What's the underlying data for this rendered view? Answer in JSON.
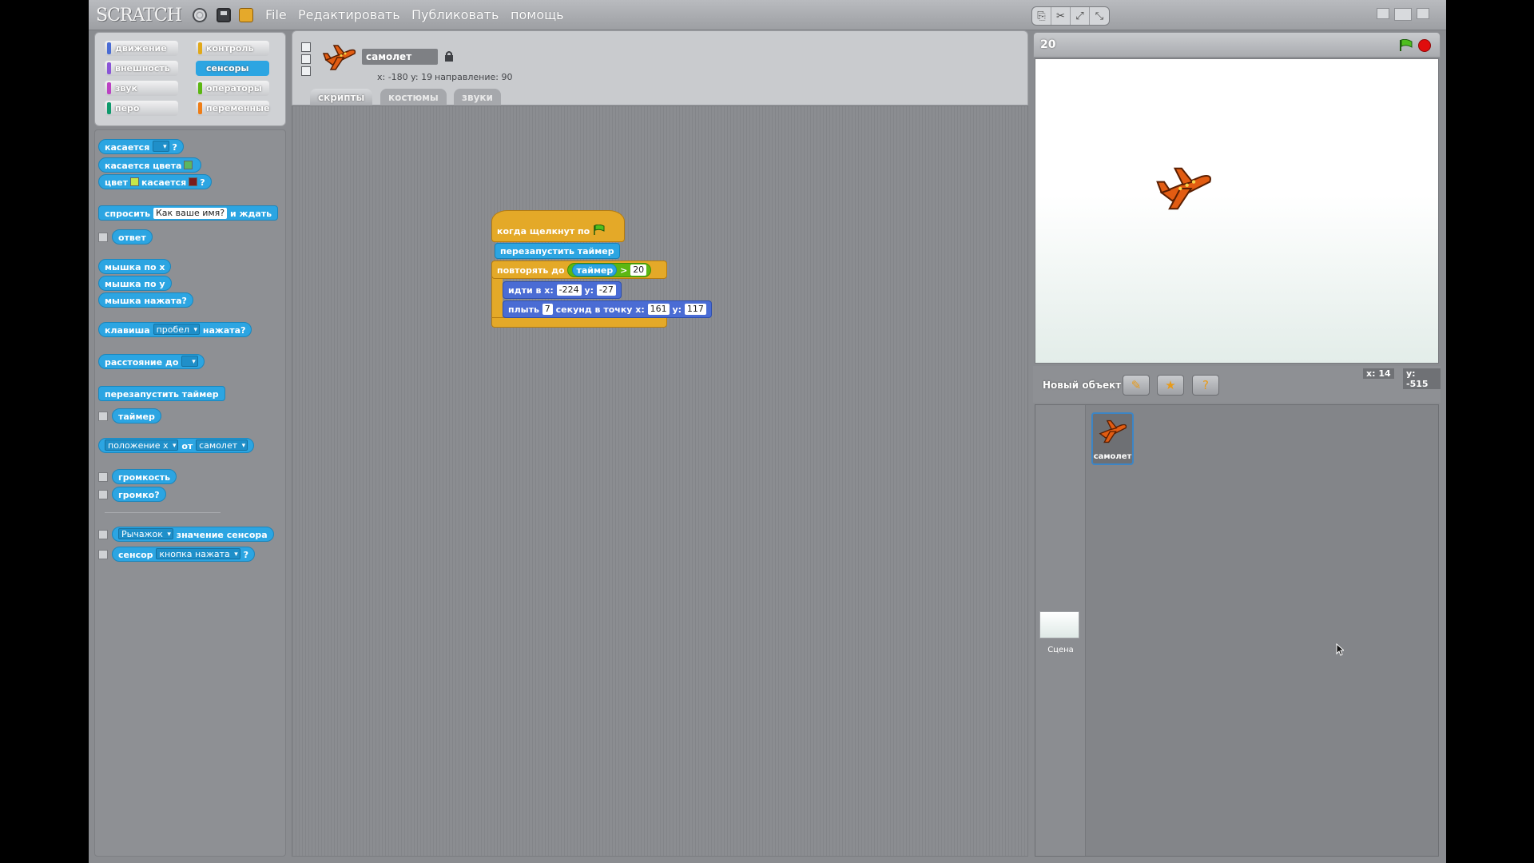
{
  "app": {
    "logo": "SCRATCH",
    "menu": [
      "File",
      "Редактировать",
      "Публиковать",
      "помощь"
    ]
  },
  "categories": [
    {
      "label": "движение",
      "color": "#4a6cd4"
    },
    {
      "label": "контроль",
      "color": "#e1a91a"
    },
    {
      "label": "внешность",
      "color": "#8a55d7"
    },
    {
      "label": "сенсоры",
      "color": "#2ca5e2"
    },
    {
      "label": "звук",
      "color": "#bb42c3"
    },
    {
      "label": "операторы",
      "color": "#5cb712"
    },
    {
      "label": "перо",
      "color": "#0e9a6c"
    },
    {
      "label": "переменные",
      "color": "#ee7d16"
    }
  ],
  "palette": {
    "touching": "касается",
    "touching_color": "касается цвета",
    "color_word": "цвет",
    "color_touching": "касается",
    "q": "?",
    "ask": "спросить",
    "ask_default": "Как ваше имя?",
    "and_wait": "и ждать",
    "answer": "ответ",
    "mouse_x": "мышка по x",
    "mouse_y": "мышка по y",
    "mouse_down": "мышка нажата?",
    "key": "клавиша",
    "key_value": "пробел",
    "pressed": "нажата?",
    "distance": "расстояние до",
    "reset_timer": "перезапустить таймер",
    "timer": "таймер",
    "position_x": "положение x",
    "of": "от",
    "of_sprite": "самолет",
    "loudness": "громкость",
    "loud": "громко?",
    "slider": "Рычажок",
    "sensor_value": "значение сенсора",
    "sensor": "сенсор",
    "button_pressed": "кнопка нажата"
  },
  "sprite": {
    "name": "самолет",
    "coords": "x: -180  y: 19",
    "direction": "направление: 90"
  },
  "tabs": [
    "скрипты",
    "костюмы",
    "звуки"
  ],
  "script": {
    "when_clicked": "когда щелкнут по",
    "reset_timer": "перезапустить таймер",
    "repeat_until": "повторять до",
    "timer": "таймер",
    "gt": ">",
    "limit": "20",
    "goto": "идти в x:",
    "goto_x": "-224",
    "y_label": "y:",
    "goto_y": "-27",
    "glide": "плыть",
    "glide_secs": "7",
    "glide_to": "секунд в точку x:",
    "glide_x": "161",
    "glide_y": "117"
  },
  "stage": {
    "title": "20",
    "new_object": "Новый объект",
    "mouse_x": "x: 14",
    "mouse_y": "y: -515",
    "sprite_label": "самолет",
    "stage_label": "Сцена"
  },
  "colors": {
    "sensing": "#2ca5e2",
    "control": "#e4a928",
    "motion": "#4a6cd4",
    "operator": "#5cb712"
  }
}
